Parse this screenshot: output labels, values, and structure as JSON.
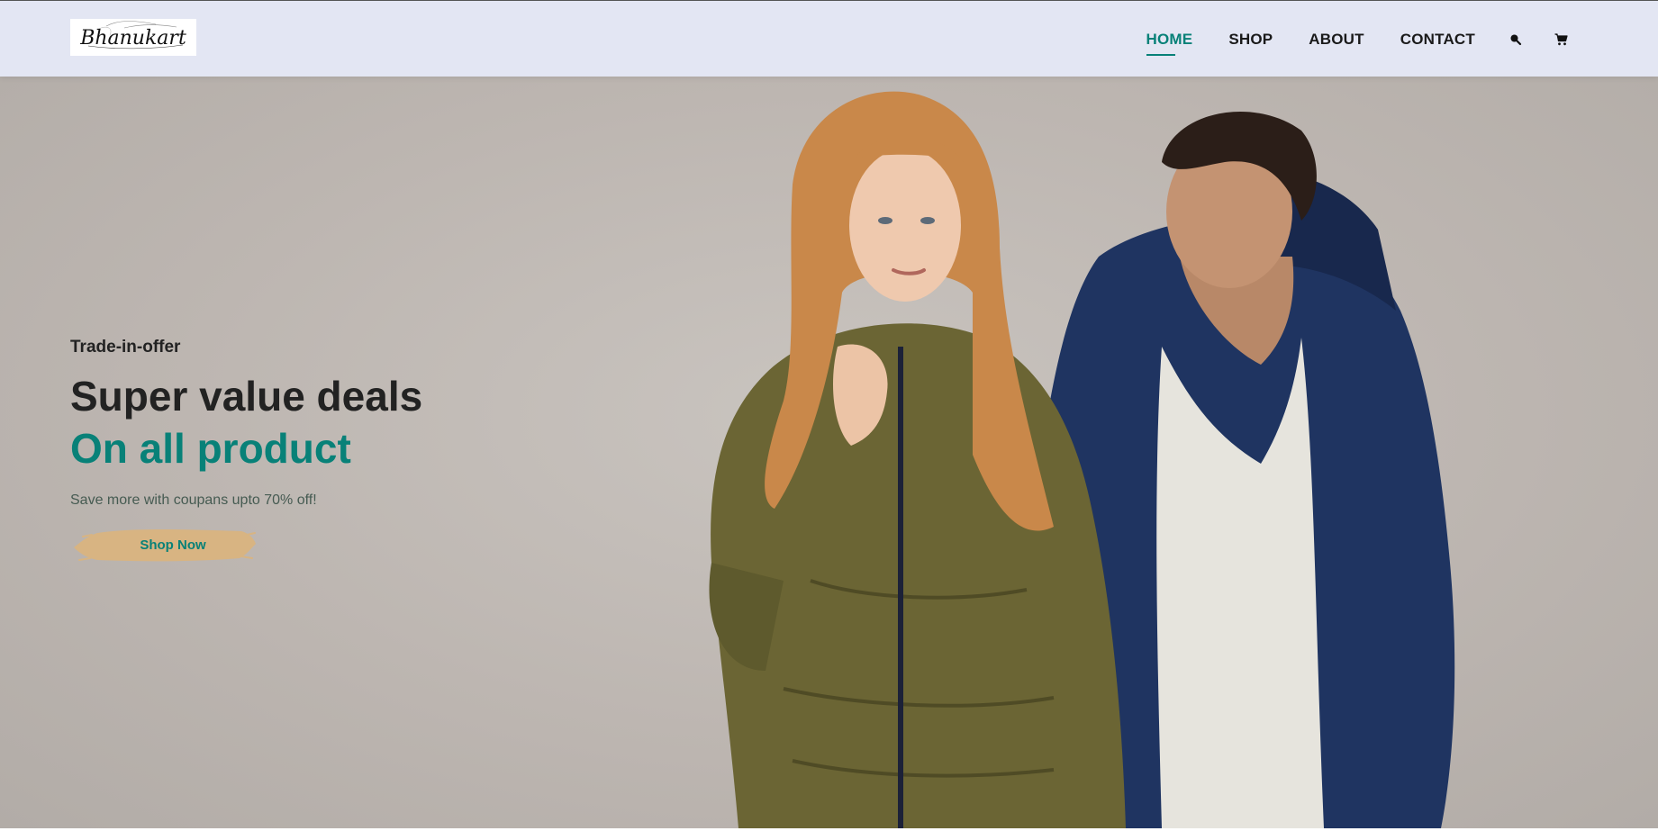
{
  "header": {
    "logo_text": "Bhanukart",
    "nav": [
      {
        "label": "HOME",
        "active": true
      },
      {
        "label": "SHOP",
        "active": false
      },
      {
        "label": "ABOUT",
        "active": false
      },
      {
        "label": "CONTACT",
        "active": false
      }
    ],
    "icons": [
      "search-icon",
      "cart-icon"
    ]
  },
  "hero": {
    "offer": "Trade-in-offer",
    "title_line1": "Super value deals",
    "title_line2": "On all product",
    "subtitle": "Save more with coupans upto 70% off!",
    "button_label": "Shop Now"
  },
  "colors": {
    "accent": "#088178",
    "header_bg": "#e3e6f3",
    "button_brush": "#d8b482"
  }
}
